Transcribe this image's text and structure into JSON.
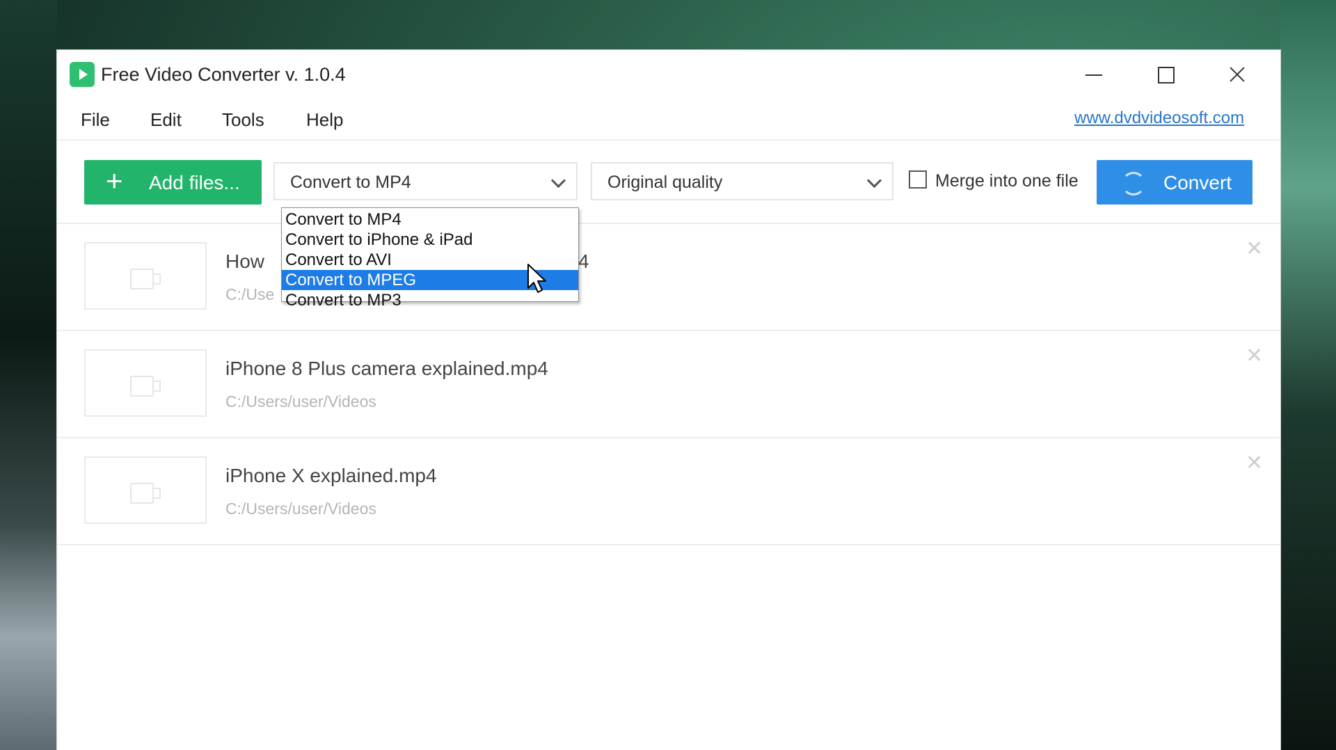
{
  "window": {
    "title": "Free Video Converter v. 1.0.4"
  },
  "menu": {
    "file": "File",
    "edit": "Edit",
    "tools": "Tools",
    "help": "Help",
    "website": "www.dvdvideosoft.com"
  },
  "toolbar": {
    "add_files_label": "Add files...",
    "format_selected": "Convert to MP4",
    "quality_selected": "Original quality",
    "merge_label": "Merge into one file",
    "merge_checked": false,
    "convert_label": "Convert"
  },
  "format_dropdown": {
    "options": [
      "Convert to MP4",
      "Convert to iPhone & iPad",
      "Convert to AVI",
      "Convert to MPEG",
      "Convert to MP3"
    ],
    "highlighted": "Convert to MPEG"
  },
  "files": [
    {
      "name": "How",
      "name_tail": "4",
      "path": "C:/Use"
    },
    {
      "name": "iPhone 8 Plus camera explained.mp4",
      "path": "C:/Users/user/Videos"
    },
    {
      "name": "iPhone X explained.mp4",
      "path": "C:/Users/user/Videos"
    }
  ],
  "colors": {
    "add_button": "#22b46a",
    "convert_button": "#2f8fe6",
    "selection": "#1e7ce6",
    "link": "#2a76c9"
  }
}
